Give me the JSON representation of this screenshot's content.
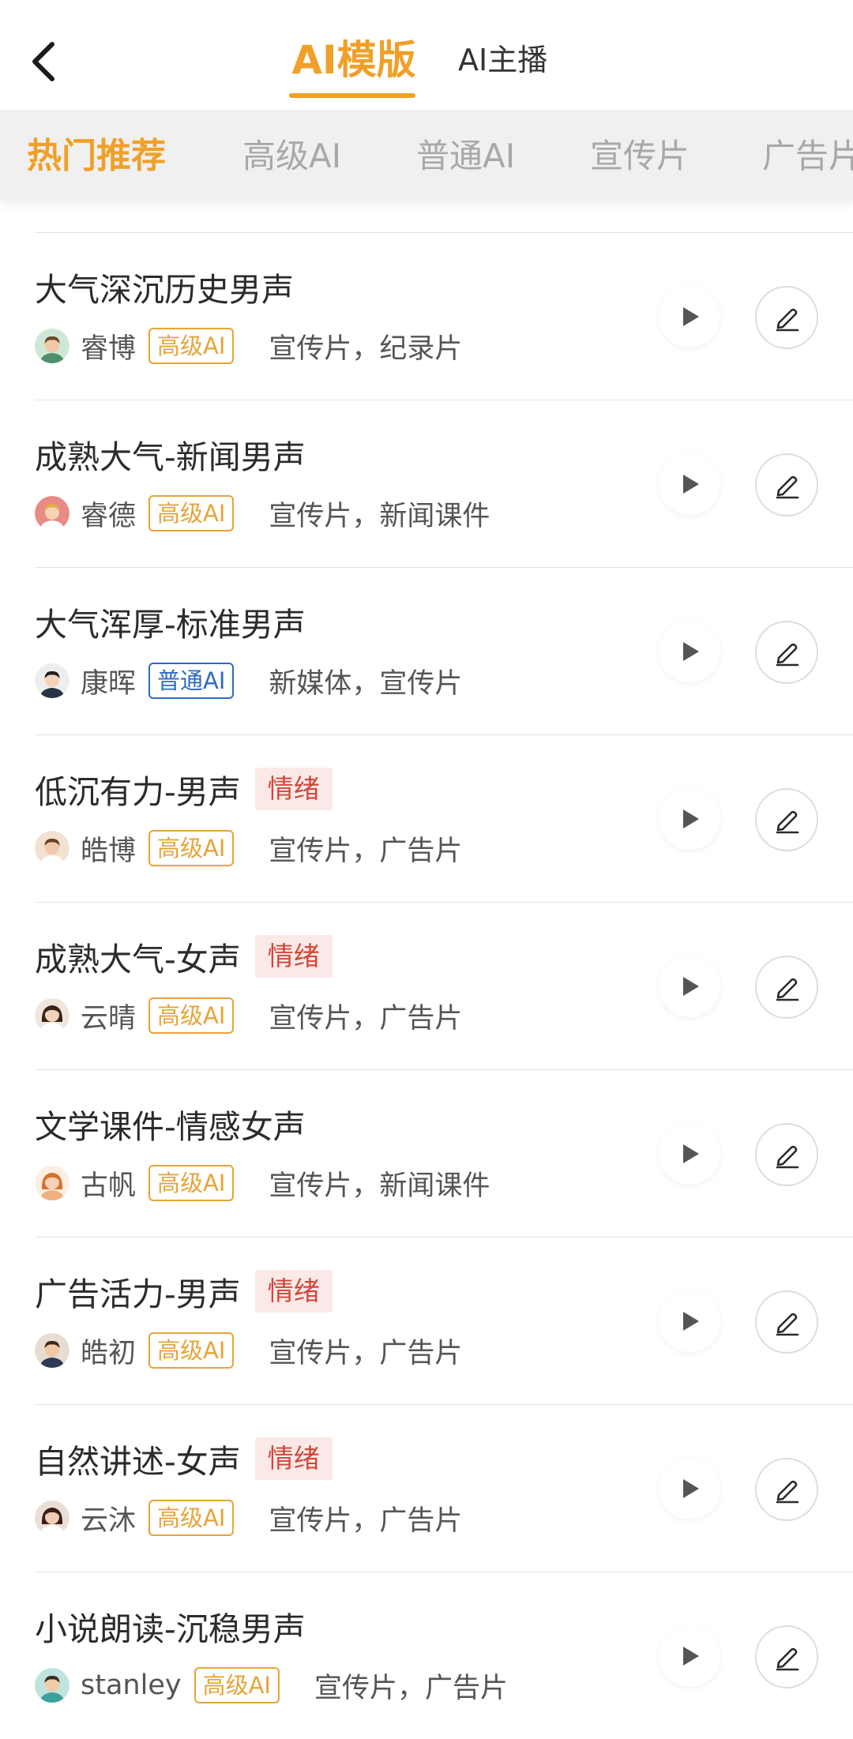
{
  "header": {
    "tabs": [
      {
        "label": "AI模版",
        "active": true
      },
      {
        "label": "AI主播",
        "active": false
      }
    ]
  },
  "categories": [
    {
      "label": "热门推荐",
      "active": true
    },
    {
      "label": "高级AI",
      "active": false
    },
    {
      "label": "普通AI",
      "active": false
    },
    {
      "label": "宣传片",
      "active": false
    },
    {
      "label": "广告片",
      "active": false
    }
  ],
  "colors": {
    "accent": "#f0a028",
    "advanced_badge": "#e6a43a",
    "basic_badge": "#2f6bc2",
    "emotion_badge_text": "#d0473a",
    "emotion_badge_bg": "#fbe9e7"
  },
  "items": [
    {
      "title": "大气深沉历史男声",
      "emotion": "",
      "voice": "睿博",
      "level": "高级AI",
      "tags": "宣传片，纪录片",
      "avatar": "male-green-shirt"
    },
    {
      "title": "成熟大气-新闻男声",
      "emotion": "",
      "voice": "睿德",
      "level": "高级AI",
      "tags": "宣传片，新闻课件",
      "avatar": "male-pink-bg"
    },
    {
      "title": "大气浑厚-标准男声",
      "emotion": "",
      "voice": "康晖",
      "level": "普通AI",
      "tags": "新媒体，宣传片",
      "avatar": "male-suit"
    },
    {
      "title": "低沉有力-男声",
      "emotion": "情绪",
      "voice": "皓博",
      "level": "高级AI",
      "tags": "宣传片，广告片",
      "avatar": "male-curly"
    },
    {
      "title": "成熟大气-女声",
      "emotion": "情绪",
      "voice": "云晴",
      "level": "高级AI",
      "tags": "宣传片，广告片",
      "avatar": "female-dark-hair"
    },
    {
      "title": "文学课件-情感女声",
      "emotion": "",
      "voice": "古帆",
      "level": "高级AI",
      "tags": "宣传片，新闻课件",
      "avatar": "female-orange-hair"
    },
    {
      "title": "广告活力-男声",
      "emotion": "情绪",
      "voice": "皓初",
      "level": "高级AI",
      "tags": "宣传片，广告片",
      "avatar": "male-mic"
    },
    {
      "title": "自然讲述-女声",
      "emotion": "情绪",
      "voice": "云沐",
      "level": "高级AI",
      "tags": "宣传片，广告片",
      "avatar": "female-long-hair"
    },
    {
      "title": "小说朗读-沉稳男声",
      "emotion": "",
      "voice": "stanley",
      "level": "高级AI",
      "tags": "宣传片，广告片",
      "avatar": "male-teal"
    }
  ]
}
